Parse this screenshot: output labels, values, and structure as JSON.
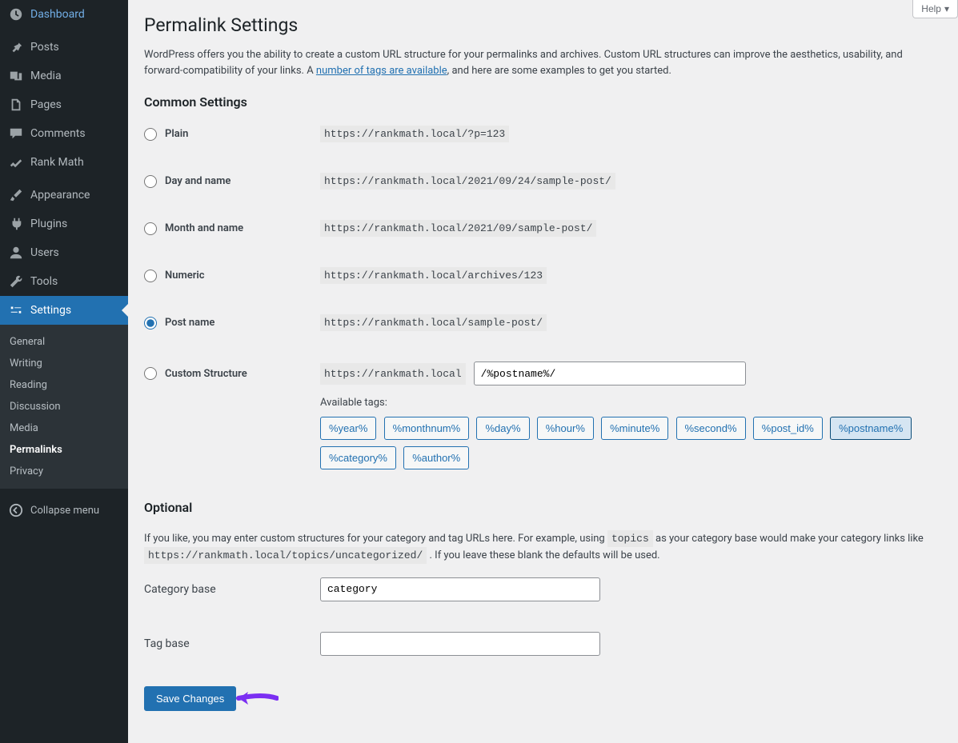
{
  "sidebar": {
    "items": [
      {
        "label": "Dashboard",
        "icon": "dashboard"
      },
      {
        "label": "Posts",
        "icon": "pin"
      },
      {
        "label": "Media",
        "icon": "media"
      },
      {
        "label": "Pages",
        "icon": "pages"
      },
      {
        "label": "Comments",
        "icon": "comment"
      },
      {
        "label": "Rank Math",
        "icon": "rankmath"
      },
      {
        "label": "Appearance",
        "icon": "brush"
      },
      {
        "label": "Plugins",
        "icon": "plugin"
      },
      {
        "label": "Users",
        "icon": "user"
      },
      {
        "label": "Tools",
        "icon": "wrench"
      },
      {
        "label": "Settings",
        "icon": "settings"
      }
    ],
    "submenu": [
      "General",
      "Writing",
      "Reading",
      "Discussion",
      "Media",
      "Permalinks",
      "Privacy"
    ],
    "collapse": "Collapse menu"
  },
  "help_label": "Help",
  "page_title": "Permalink Settings",
  "intro": {
    "p1": "WordPress offers you the ability to create a custom URL structure for your permalinks and archives. Custom URL structures can improve the aesthetics, usability, and forward-compatibility of your links. A ",
    "link": "number of tags are available",
    "p2": ", and here are some examples to get you started."
  },
  "section_common": "Common Settings",
  "permalinks": [
    {
      "label": "Plain",
      "example": "https://rankmath.local/?p=123",
      "checked": false
    },
    {
      "label": "Day and name",
      "example": "https://rankmath.local/2021/09/24/sample-post/",
      "checked": false
    },
    {
      "label": "Month and name",
      "example": "https://rankmath.local/2021/09/sample-post/",
      "checked": false
    },
    {
      "label": "Numeric",
      "example": "https://rankmath.local/archives/123",
      "checked": false
    },
    {
      "label": "Post name",
      "example": "https://rankmath.local/sample-post/",
      "checked": true
    },
    {
      "label": "Custom Structure",
      "prefix": "https://rankmath.local",
      "value": "/%postname%/",
      "checked": false
    }
  ],
  "tags_label": "Available tags:",
  "tags": [
    "%year%",
    "%monthnum%",
    "%day%",
    "%hour%",
    "%minute%",
    "%second%",
    "%post_id%",
    "%postname%",
    "%category%",
    "%author%"
  ],
  "active_tag": "%postname%",
  "section_optional": "Optional",
  "optional_text": {
    "p1": "If you like, you may enter custom structures for your category and tag URLs here. For example, using ",
    "code1": "topics",
    "p2": " as your category base would make your category links like ",
    "code2": "https://rankmath.local/topics/uncategorized/",
    "p3": " . If you leave these blank the defaults will be used."
  },
  "category_base_label": "Category base",
  "category_base_value": "category",
  "tag_base_label": "Tag base",
  "tag_base_value": "",
  "submit_label": "Save Changes"
}
